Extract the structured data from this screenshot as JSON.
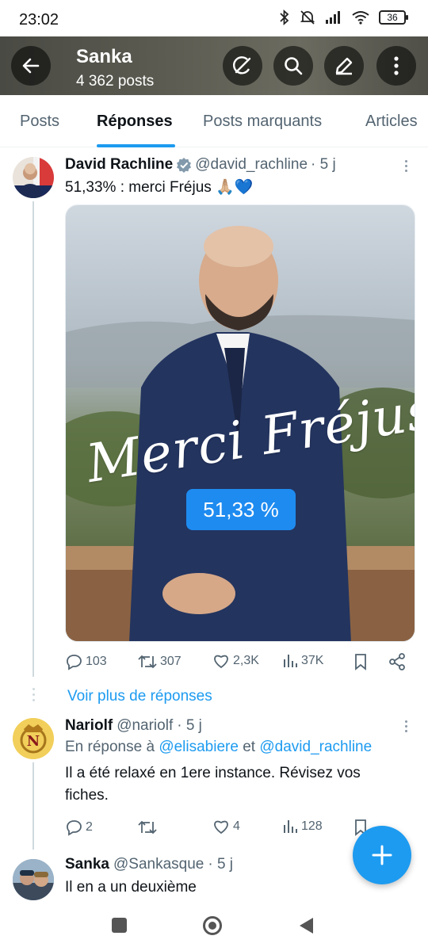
{
  "status_bar": {
    "time": "23:02",
    "battery": "36"
  },
  "header": {
    "title": "Sanka",
    "posts_count": "4 362 posts"
  },
  "tabs": [
    {
      "label": "Posts",
      "active": false
    },
    {
      "label": "Réponses",
      "active": true
    },
    {
      "label": "Posts marquants",
      "active": false
    },
    {
      "label": "Articles",
      "active": false
    }
  ],
  "tweets": [
    {
      "name": "David Rachline",
      "verified": true,
      "handle": "@david_rachline",
      "time": "· 5 j",
      "text": "51,33% : merci Fréjus 🙏🏼💙",
      "media": {
        "script_text": "Merci Fréjus !",
        "badge": "51,33 %"
      },
      "stats": {
        "replies": "103",
        "reposts": "307",
        "likes": "2,3K",
        "views": "37K"
      }
    },
    {
      "name": "Nariolf",
      "handle": "@nariolf",
      "time": "· 5 j",
      "reply_prefix": "En réponse à",
      "reply_to_1": "@elisabiere",
      "reply_join": "et",
      "reply_to_2": "@david_rachline",
      "text": "Il a été relaxé en 1ere instance. Révisez vos fiches.",
      "stats": {
        "replies": "2",
        "reposts": "",
        "likes": "4",
        "views": "128"
      }
    },
    {
      "name": "Sanka",
      "handle": "@Sankasque",
      "time": "· 5 j",
      "text": "Il en a un deuxième"
    }
  ],
  "show_more_replies": "Voir plus de réponses",
  "colors": {
    "accent": "#1d9bf0",
    "text": "#0f1419",
    "muted": "#536471"
  }
}
